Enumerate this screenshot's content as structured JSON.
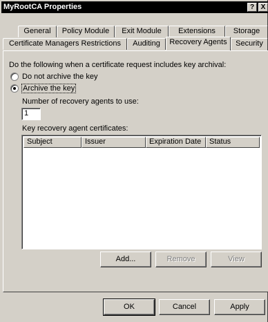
{
  "window": {
    "title": "MyRootCA Properties",
    "help_btn": "?",
    "close_btn": "X"
  },
  "tabs_row1": [
    "General",
    "Policy Module",
    "Exit Module",
    "Extensions",
    "Storage"
  ],
  "tabs_row2": [
    "Certificate Managers Restrictions",
    "Auditing",
    "Recovery Agents",
    "Security"
  ],
  "active_tab": "Recovery Agents",
  "panel": {
    "instruction": "Do the following when a certificate request includes key archival:",
    "radio_no_archive": "Do not archive the key",
    "radio_archive": "Archive the key",
    "selected_radio": "Archive the key",
    "num_agents_label": "Number of recovery agents to use:",
    "num_agents_value": "1",
    "certs_label": "Key recovery agent certificates:",
    "columns": [
      "Subject",
      "Issuer",
      "Expiration Date",
      "Status"
    ],
    "add_btn": "Add...",
    "remove_btn": "Remove",
    "view_btn": "View"
  },
  "footer": {
    "ok_btn": "OK",
    "cancel_btn": "Cancel",
    "apply_btn": "Apply"
  }
}
